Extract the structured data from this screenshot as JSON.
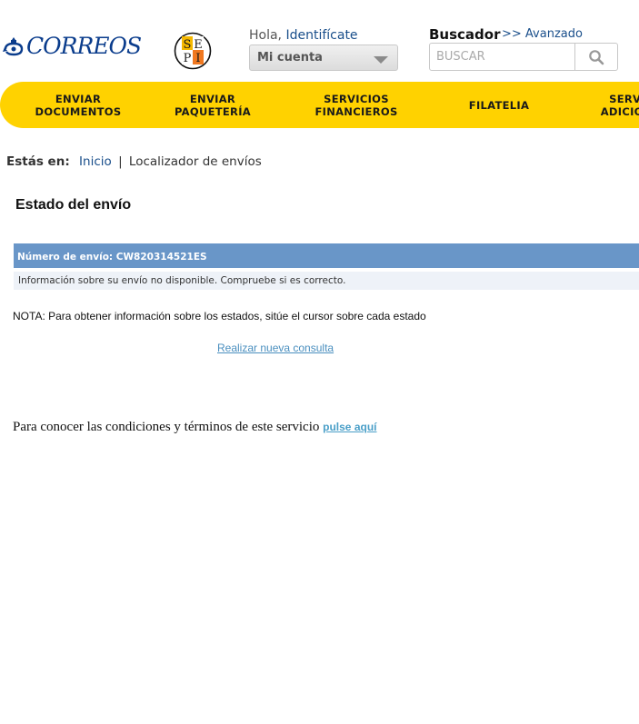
{
  "header": {
    "brand_name": "CORREOS",
    "sepi_logo_letters": [
      "S",
      "E",
      "P",
      "I"
    ],
    "greeting": "Hola,",
    "login_link": "Identifícate",
    "account_select": "Mi cuenta",
    "search_title": "Buscador",
    "search_advanced": ">> Avanzado",
    "search_placeholder": "BUSCAR",
    "brand_color": "#0a3c8c",
    "nav_color": "#ffd200"
  },
  "nav": {
    "items": [
      {
        "label": "ENVIAR\nDOCUMENTOS"
      },
      {
        "label": "ENVIAR\nPAQUETERÍA"
      },
      {
        "label": "SERVICIOS\nFINANCIEROS"
      },
      {
        "label": "FILATELIA"
      },
      {
        "label": "SERVICIOS\nADICIONALES"
      }
    ]
  },
  "breadcrumb": {
    "label": "Estás en:",
    "home": "Inicio",
    "separator": "|",
    "current": "Localizador de envíos"
  },
  "main": {
    "title": "Estado del envío",
    "shipment_header": "Número de envío: CW820314521ES",
    "shipment_message": "Información sobre su envío no disponible. Compruebe si es correcto.",
    "note": "NOTA: Para obtener información sobre los estados, sitúe el cursor sobre cada estado",
    "new_query_link": "Realizar nueva consulta",
    "terms_text": "Para conocer las condiciones y términos de este servicio",
    "terms_link": "pulse aquí"
  }
}
